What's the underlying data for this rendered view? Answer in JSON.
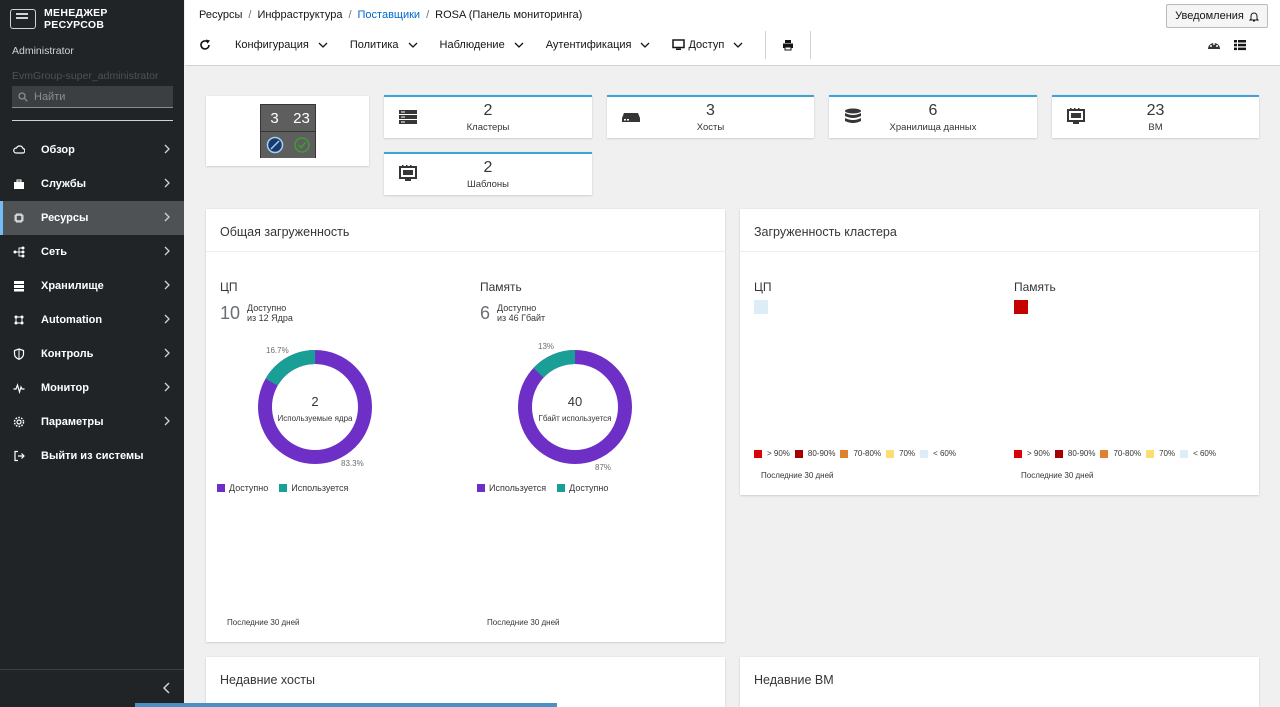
{
  "brand": {
    "line1": "МЕНЕДЖЕР",
    "line2": "РЕСУРСОВ"
  },
  "user": {
    "name": "Administrator",
    "group": "EvmGroup-super_administrator"
  },
  "search": {
    "placeholder": "Найти"
  },
  "sidebar": {
    "items": [
      {
        "label": "Обзор",
        "icon": "cloud-icon",
        "chevron": true
      },
      {
        "label": "Службы",
        "icon": "briefcase-icon",
        "chevron": true
      },
      {
        "label": "Ресурсы",
        "icon": "resources-icon",
        "chevron": true,
        "active": true
      },
      {
        "label": "Сеть",
        "icon": "network-icon",
        "chevron": true
      },
      {
        "label": "Хранилище",
        "icon": "storage-icon",
        "chevron": true
      },
      {
        "label": "Automation",
        "icon": "automation-icon",
        "chevron": true
      },
      {
        "label": "Контроль",
        "icon": "shield-icon",
        "chevron": true
      },
      {
        "label": "Монитор",
        "icon": "pulse-icon",
        "chevron": true
      },
      {
        "label": "Параметры",
        "icon": "gear-icon",
        "chevron": true
      },
      {
        "label": "Выйти из системы",
        "icon": "logout-icon",
        "chevron": false
      }
    ]
  },
  "breadcrumb": {
    "items": [
      "Ресурсы",
      "Инфраструктура",
      "Поставщики",
      "ROSA (Панель мониторинга)"
    ],
    "link_index": 2
  },
  "header": {
    "notifications_label": "Уведомления"
  },
  "toolbar": {
    "items": [
      {
        "label": "Конфигурация"
      },
      {
        "label": "Политика"
      },
      {
        "label": "Наблюдение"
      },
      {
        "label": "Аутентификация"
      },
      {
        "label": "Доступ"
      }
    ]
  },
  "aggregate": {
    "top_left": "3",
    "top_right": "23"
  },
  "stats": [
    {
      "value": "2",
      "label": "Кластеры",
      "icon": "cluster-icon"
    },
    {
      "value": "3",
      "label": "Хосты",
      "icon": "host-icon"
    },
    {
      "value": "6",
      "label": "Хранилища данных",
      "icon": "datastore-icon"
    },
    {
      "value": "23",
      "label": "ВМ",
      "icon": "vm-icon"
    },
    {
      "value": "2",
      "label": "Шаблоны",
      "icon": "template-icon"
    }
  ],
  "utilization": {
    "title": "Общая загруженность",
    "cpu": {
      "title": "ЦП",
      "available": "10",
      "available_label": "Доступно",
      "of_label": "из 12 Ядра",
      "center_value": "2",
      "center_label": "Используемые ядра",
      "used_fraction": 0.167,
      "used_pct_label": "16.7%",
      "avail_pct_label": "83.3%",
      "legend": [
        "Доступно",
        "Используется"
      ]
    },
    "memory": {
      "title": "Память",
      "available": "6",
      "available_label": "Доступно",
      "of_label": "из 46 Гбайт",
      "center_value": "40",
      "center_label": "Гбайт используется",
      "used_fraction": 0.13,
      "used_pct_label": "13%",
      "avail_pct_label": "87%",
      "legend": [
        "Используется",
        "Доступно"
      ]
    },
    "footer": "Последние 30 дней",
    "colors": {
      "purple": "#6e2fc7",
      "teal": "#1a9f96"
    }
  },
  "cluster": {
    "title": "Загруженность кластера",
    "cpu_title": "ЦП",
    "mem_title": "Память",
    "legend": [
      {
        "label": "> 90%",
        "color": "#d80404"
      },
      {
        "label": "80-90%",
        "color": "#a30000"
      },
      {
        "label": "70-80%",
        "color": "#e0822b"
      },
      {
        "label": "70%",
        "color": "#fbdf73"
      },
      {
        "label": "< 60%",
        "color": "#dcedf7"
      }
    ],
    "cpu_cell_color": "#dcedf7",
    "mem_cell_color": "#c50000",
    "footer": "Последние 30 дней"
  },
  "recent": {
    "hosts_title": "Недавние хосты",
    "vms_title": "Недавние ВМ"
  }
}
